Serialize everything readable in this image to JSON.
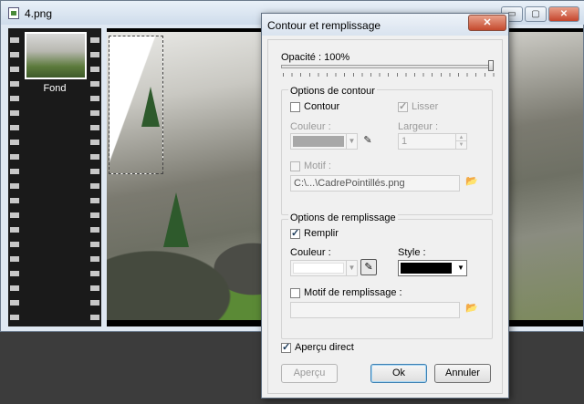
{
  "window": {
    "title": "4.png",
    "min": "▭",
    "max": "▢",
    "close": "✕"
  },
  "filmstrip": {
    "items": [
      {
        "label": "Fond"
      }
    ]
  },
  "dialog": {
    "title": "Contour et remplissage",
    "close": "✕",
    "opacity_label": "Opacité : 100%",
    "opacity_value": 100,
    "stroke": {
      "group_title": "Options de contour",
      "contour_label": "Contour",
      "contour_checked": false,
      "smooth_label": "Lisser",
      "smooth_checked": true,
      "color_label": "Couleur :",
      "width_label": "Largeur :",
      "width_value": "1",
      "pattern_label": "Motif :",
      "pattern_value": "C:\\...\\CadrePointillés.png",
      "color_value": "#a8a8a8"
    },
    "fill": {
      "group_title": "Options de remplissage",
      "fill_label": "Remplir",
      "fill_checked": true,
      "color_label": "Couleur :",
      "style_label": "Style :",
      "color_value": "#ffffff",
      "style_value": "#000000",
      "pattern_label": "Motif de remplissage :",
      "pattern_checked": false,
      "pattern_value": ""
    },
    "preview_label": "Aperçu direct",
    "preview_checked": true,
    "buttons": {
      "apercu": "Aperçu",
      "ok": "Ok",
      "cancel": "Annuler"
    },
    "icons": {
      "eyedropper": "✎",
      "folder": "📂",
      "dropdown": "▼"
    }
  }
}
